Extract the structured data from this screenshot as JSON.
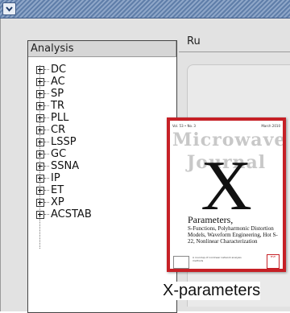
{
  "window": {
    "menu_icon": "chevron-down-icon"
  },
  "tree": {
    "header": "Analysis",
    "items": [
      "DC",
      "AC",
      "SP",
      "TR",
      "PLL",
      "CR",
      "LSSP",
      "GC",
      "SSNA",
      "IP",
      "ET",
      "XP",
      "ACSTAB"
    ]
  },
  "right_tab": {
    "label": "Ru"
  },
  "magazine": {
    "top_left": "Vol. 53 • No. 3",
    "top_right": "March 2010",
    "title": "Microwave Journal",
    "big_letter": "X",
    "headline": "Parameters,",
    "subtitle": "S-Functions, Polyharmonic Distortion Models, Waveform Engineering, Hot S-22, Nonlinear Characterization",
    "footer": "A roundup of nonlinear network analysis methods",
    "badge": "MVP"
  },
  "caption": "X-parameters",
  "colors": {
    "titlebar": "#6f8db5",
    "magazine_border": "#c62026"
  }
}
